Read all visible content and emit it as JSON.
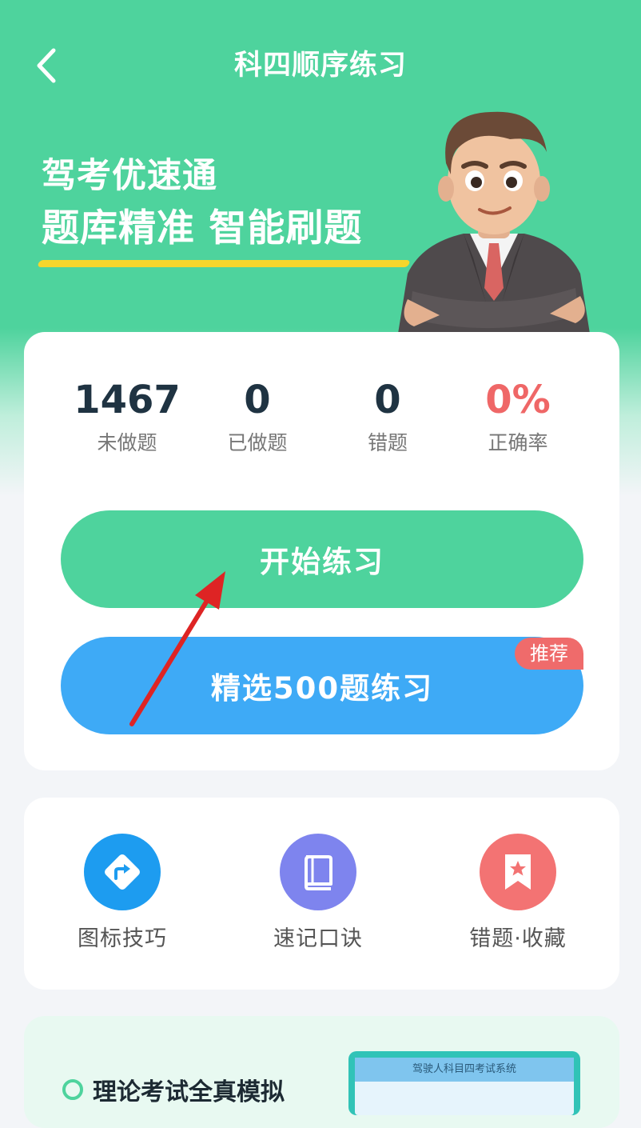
{
  "header": {
    "title": "科四顺序练习",
    "back_icon": "chevron-left-icon"
  },
  "banner": {
    "line1": "驾考优速通",
    "line2": "题库精准 智能刷题"
  },
  "stats": [
    {
      "value": "1467",
      "label": "未做题"
    },
    {
      "value": "0",
      "label": "已做题"
    },
    {
      "value": "0",
      "label": "错题"
    },
    {
      "value": "0%",
      "label": "正确率"
    }
  ],
  "buttons": {
    "start": "开始练习",
    "select500": "精选500题练习",
    "badge": "推荐"
  },
  "tools": [
    {
      "label": "图标技巧",
      "icon": "road-sign-icon",
      "color": "#1d9cf0"
    },
    {
      "label": "速记口诀",
      "icon": "book-icon",
      "color": "#7e84ee"
    },
    {
      "label": "错题·收藏",
      "icon": "bookmark-star-icon",
      "color": "#f37373"
    }
  ],
  "exam": {
    "title": "理论考试全真模拟",
    "thumb_title": "驾驶人科目四考试系统"
  },
  "colors": {
    "primary": "#4ed39d",
    "blue": "#3eaaf6",
    "red": "#ef6767",
    "yellow": "#f5d62c"
  }
}
